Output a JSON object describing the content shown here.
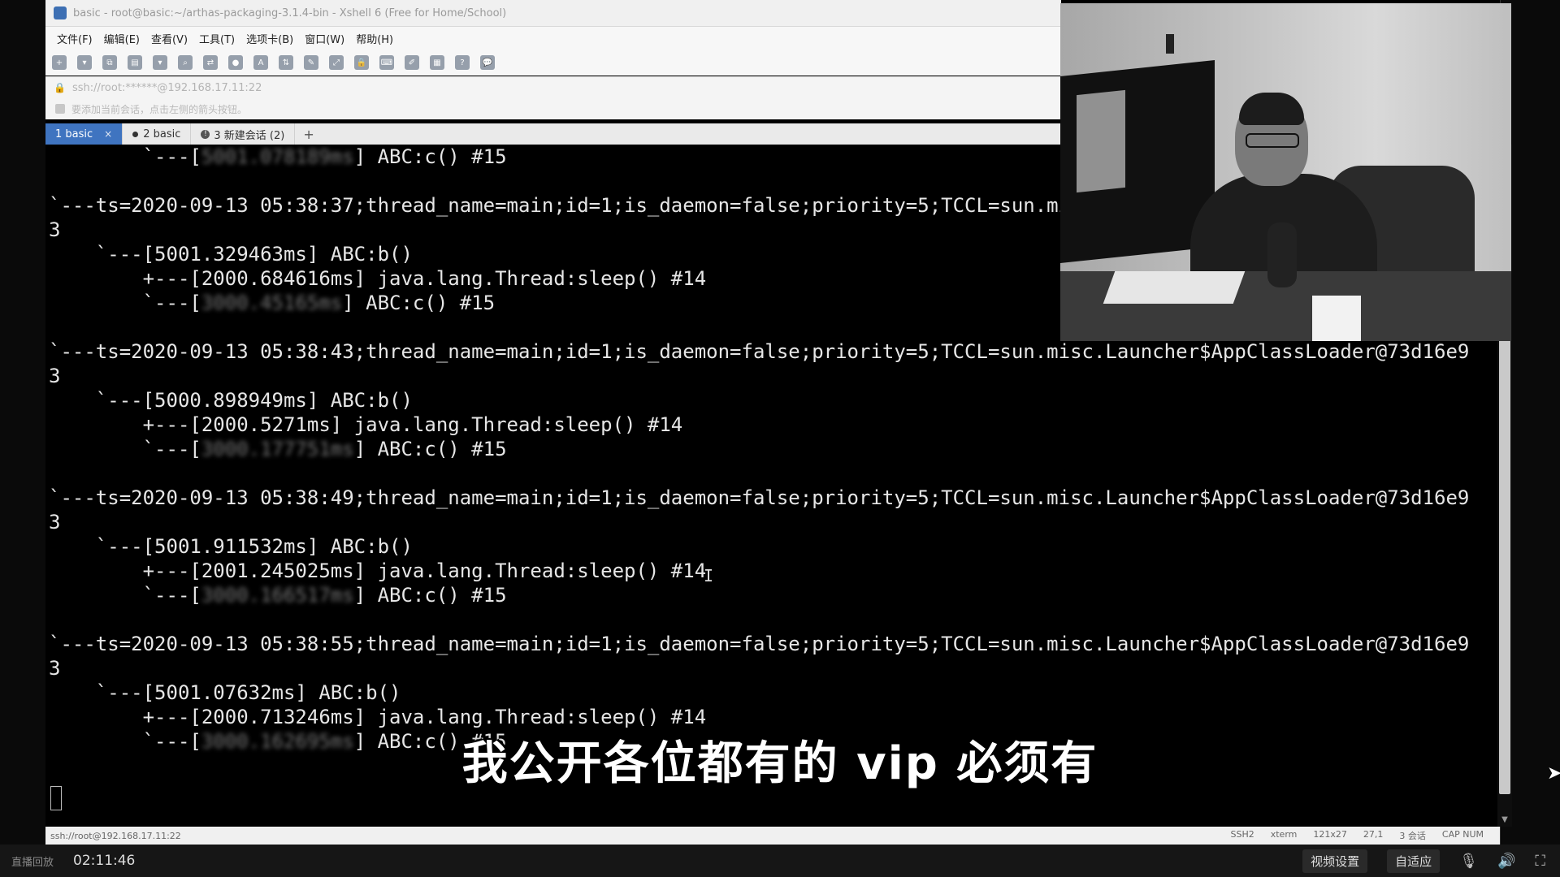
{
  "window": {
    "title": "basic - root@basic:~/arthas-packaging-3.1.4-bin - Xshell 6 (Free for Home/School)",
    "menu": [
      "文件(F)",
      "编辑(E)",
      "查看(V)",
      "工具(T)",
      "选项卡(B)",
      "窗口(W)",
      "帮助(H)"
    ],
    "address": "ssh://root:******@192.168.17.11:22",
    "hint": "要添加当前会话，点击左侧的箭头按钮。",
    "tabs": [
      {
        "label": "1 basic",
        "close": "×"
      },
      {
        "label": "2 basic"
      },
      {
        "label": "3 新建会话 (2)"
      }
    ],
    "add_tab": "+"
  },
  "terminal": {
    "lines": [
      {
        "pre": "        `---[",
        "blur": "5001.078189ms",
        "post": "] ABC:c() #15"
      },
      {
        "text": ""
      },
      {
        "text": "`---ts=2020-09-13 05:38:37;thread_name=main;id=1;is_daemon=false;priority=5;TCCL=sun.misc.Launcher$AppClassLoader@73d16e9"
      },
      {
        "text": "3"
      },
      {
        "text": "    `---[5001.329463ms] ABC:b()"
      },
      {
        "text": "        +---[2000.684616ms] java.lang.Thread:sleep() #14"
      },
      {
        "pre": "        `---[",
        "blur": "3000.45165ms",
        "post": "] ABC:c() #15"
      },
      {
        "text": ""
      },
      {
        "text": "`---ts=2020-09-13 05:38:43;thread_name=main;id=1;is_daemon=false;priority=5;TCCL=sun.misc.Launcher$AppClassLoader@73d16e9"
      },
      {
        "text": "3"
      },
      {
        "text": "    `---[5000.898949ms] ABC:b()"
      },
      {
        "text": "        +---[2000.5271ms] java.lang.Thread:sleep() #14"
      },
      {
        "pre": "        `---[",
        "blur": "3000.177751ms",
        "post": "] ABC:c() #15"
      },
      {
        "text": ""
      },
      {
        "text": "`---ts=2020-09-13 05:38:49;thread_name=main;id=1;is_daemon=false;priority=5;TCCL=sun.misc.Launcher$AppClassLoader@73d16e9"
      },
      {
        "text": "3"
      },
      {
        "text": "    `---[5001.911532ms] ABC:b()"
      },
      {
        "text": "        +---[2001.245025ms] java.lang.Thread:sleep() #14"
      },
      {
        "pre": "        `---[",
        "blur": "3000.166517ms",
        "post": "] ABC:c() #15"
      },
      {
        "text": ""
      },
      {
        "text": "`---ts=2020-09-13 05:38:55;thread_name=main;id=1;is_daemon=false;priority=5;TCCL=sun.misc.Launcher$AppClassLoader@73d16e9"
      },
      {
        "text": "3"
      },
      {
        "text": "    `---[5001.07632ms] ABC:b()"
      },
      {
        "text": "        +---[2000.713246ms] java.lang.Thread:sleep() #14"
      },
      {
        "pre": "        `---[",
        "blur": "3000.162695ms",
        "post": "] ABC:c() #15"
      }
    ]
  },
  "statusbar": {
    "left": "ssh://root@192.168.17.11:22",
    "protocol": "SSH2",
    "term": "xterm",
    "size": "121x27",
    "cursor": "27,1",
    "sessions": "3 会话",
    "caps": "CAP NUM"
  },
  "subtitle": "我公开各位都有的 vip 必须有",
  "player": {
    "live_label": "直播回放",
    "time": "02:11:46",
    "settings_label": "视频设置",
    "fit_label": "自适应"
  }
}
